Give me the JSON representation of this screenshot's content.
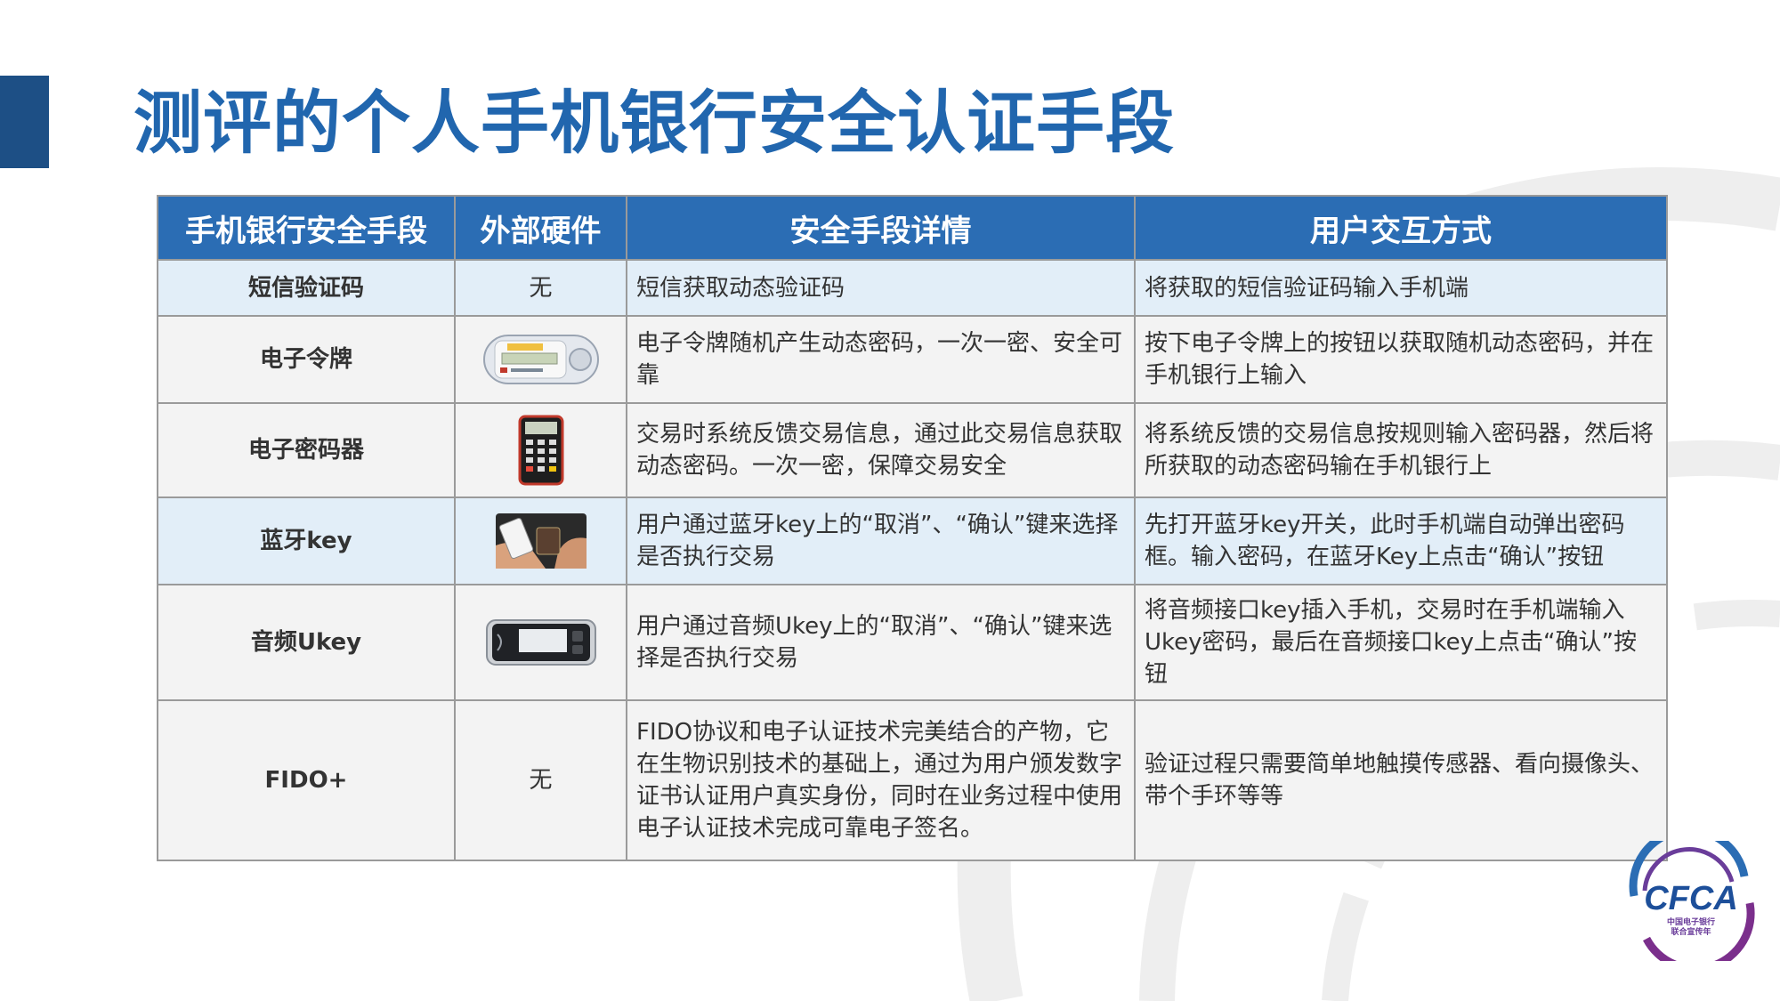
{
  "title": "测评的个人手机银行安全认证手段",
  "table": {
    "headers": [
      "手机银行安全手段",
      "外部硬件",
      "安全手段详情",
      "用户交互方式"
    ],
    "rows": [
      {
        "name": "短信验证码",
        "hardware": "无",
        "hardware_icon": "none",
        "detail": "短信获取动态验证码",
        "interaction": "将获取的短信验证码输入手机端"
      },
      {
        "name": "电子令牌",
        "hardware": "",
        "hardware_icon": "token-icon",
        "detail": "电子令牌随机产生动态密码，一次一密、安全可靠",
        "interaction": "按下电子令牌上的按钮以获取随机动态密码，并在手机银行上输入"
      },
      {
        "name": "电子密码器",
        "hardware": "",
        "hardware_icon": "password-device-icon",
        "detail": "交易时系统反馈交易信息，通过此交易信息获取动态密码。一次一密，保障交易安全",
        "interaction": "将系统反馈的交易信息按规则输入密码器，然后将所获取的动态密码输在手机银行上"
      },
      {
        "name": "蓝牙key",
        "hardware": "",
        "hardware_icon": "bluetooth-key-icon",
        "detail": "用户通过蓝牙key上的“取消”、“确认”键来选择是否执行交易",
        "interaction": "先打开蓝牙key开关，此时手机端自动弹出密码框。输入密码，在蓝牙Key上点击“确认”按钮"
      },
      {
        "name": "音频Ukey",
        "hardware": "",
        "hardware_icon": "audio-ukey-icon",
        "detail": "用户通过音频Ukey上的“取消”、“确认”键来选择是否执行交易",
        "interaction": "将音频接口key插入手机，交易时在手机端输入Ukey密码，最后在音频接口key上点击“确认”按钮"
      },
      {
        "name": "FIDO+",
        "hardware": "无",
        "hardware_icon": "none",
        "detail": "FIDO协议和电子认证技术完美结合的产物，它在生物识别技术的基础上，通过为用户颁发数字证书认证用户真实身份，同时在业务过程中使用电子认证技术完成可靠电子签名。",
        "interaction": "验证过程只需要简单地触摸传感器、看向摄像头、带个手环等等"
      }
    ]
  },
  "logo": {
    "text": "CFCA",
    "subtext_line1": "中国电子银行",
    "subtext_line2": "联合宣传年"
  },
  "colors": {
    "title": "#2166ae",
    "header_bg": "#2b6db4",
    "accent_bar": "#1d4f85",
    "row_alt": "#e2eef8"
  }
}
